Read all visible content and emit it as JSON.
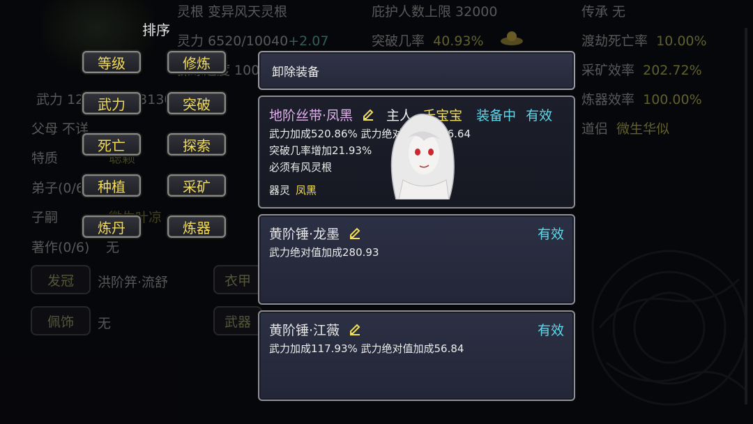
{
  "background": {
    "col1": {
      "wuli": "武力 1202",
      "wuli_hidden": "0/2383130",
      "parents": "父母 不详",
      "traits": "特质",
      "trait_value": "聪颖",
      "disciples": "弟子(0/6)",
      "heirs": "子嗣",
      "heir_value": "微生叶凉",
      "works": "著作(0/6)",
      "works_value": "无",
      "crown_btn": "发冠",
      "crown_value": "洪阶笄·流舒",
      "accessory_btn": "佩饰",
      "accessory_value": "无",
      "armor_btn": "衣甲",
      "weapon_btn": "武器"
    },
    "col2": {
      "root": "灵根 变异风天灵根",
      "power_label": "灵力 6520/10040",
      "power_plus": "+2.07",
      "speed_label": "操练速度 100"
    },
    "col3": {
      "shelter_label": "庇护人数上限 32000",
      "break_label": "突破几率",
      "break_value": "40.93%"
    },
    "col4": {
      "inherit": "传承 无",
      "tribulation_label": "渡劫死亡率",
      "tribulation_value": "10.00%",
      "mining_label": "采矿效率",
      "mining_value": "202.72%",
      "forge_label": "炼器效率",
      "forge_value": "100.00%",
      "partner_label": "道侣",
      "partner_value": "微生华似"
    }
  },
  "sort_menu": {
    "title": "排序",
    "buttons": [
      "等级",
      "修炼",
      "武力",
      "突破",
      "死亡",
      "探索",
      "种植",
      "采矿",
      "炼丹",
      "炼器"
    ]
  },
  "equipment": {
    "unequip_label": "卸除装备",
    "items": [
      {
        "name": "地阶丝带·凤黑",
        "owner_label": "主人",
        "owner_name": "千宝宝",
        "status": "装备中",
        "valid": "有效",
        "lines": [
          "武力加成520.86% 武力绝对值加成206.64",
          "突破几率增加21.93%",
          "必须有风灵根"
        ],
        "spirit_label": "器灵",
        "spirit_value": "凤黑"
      },
      {
        "name": "黄阶锤·龙墨",
        "valid": "有效",
        "lines": [
          "武力绝对值加成280.93"
        ]
      },
      {
        "name": "黄阶锤·江薇",
        "valid": "有效",
        "lines": [
          "武力加成117.93% 武力绝对值加成56.84"
        ]
      }
    ]
  },
  "colors": {
    "gold_text": "#f3df5c",
    "cyan_text": "#5fd9ea",
    "purple_text": "#e3b2ef"
  }
}
